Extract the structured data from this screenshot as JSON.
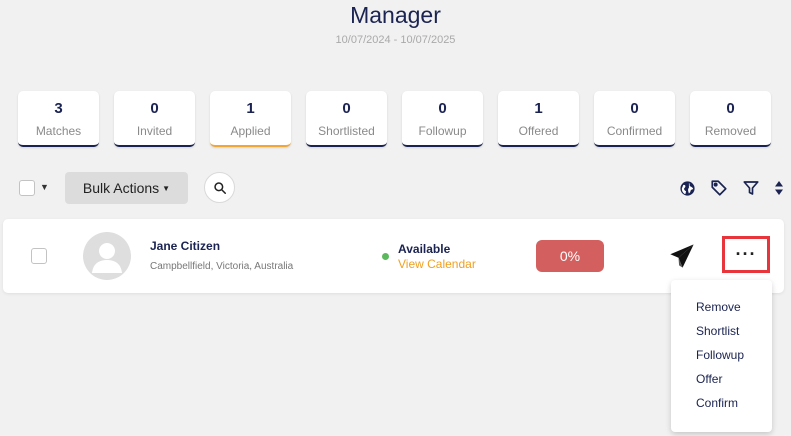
{
  "header": {
    "title": "Manager",
    "date_range": "10/07/2024 - 10/07/2025"
  },
  "stats": [
    {
      "count": "3",
      "label": "Matches",
      "active": false
    },
    {
      "count": "0",
      "label": "Invited",
      "active": false
    },
    {
      "count": "1",
      "label": "Applied",
      "active": true
    },
    {
      "count": "0",
      "label": "Shortlisted",
      "active": false
    },
    {
      "count": "0",
      "label": "Followup",
      "active": false
    },
    {
      "count": "1",
      "label": "Offered",
      "active": false
    },
    {
      "count": "0",
      "label": "Confirmed",
      "active": false
    },
    {
      "count": "0",
      "label": "Removed",
      "active": false
    }
  ],
  "toolbar": {
    "bulk_actions_label": "Bulk Actions",
    "icons": [
      "globe-icon",
      "tag-icon",
      "filter-icon",
      "sort-icon"
    ]
  },
  "candidate": {
    "name": "Jane Citizen",
    "location": "Campbellfield, Victoria, Australia",
    "availability": "Available",
    "view_calendar": "View Calendar",
    "match_percent": "0%",
    "status_color": "#5cb85c",
    "percent_color": "#d45f5f"
  },
  "more_button": {
    "label": "···"
  },
  "menu": {
    "items": [
      "Remove",
      "Shortlist",
      "Followup",
      "Offer",
      "Confirm"
    ]
  },
  "colors": {
    "navy": "#1a2351",
    "accent_orange": "#f3a536",
    "highlight_red": "#e8353b"
  }
}
